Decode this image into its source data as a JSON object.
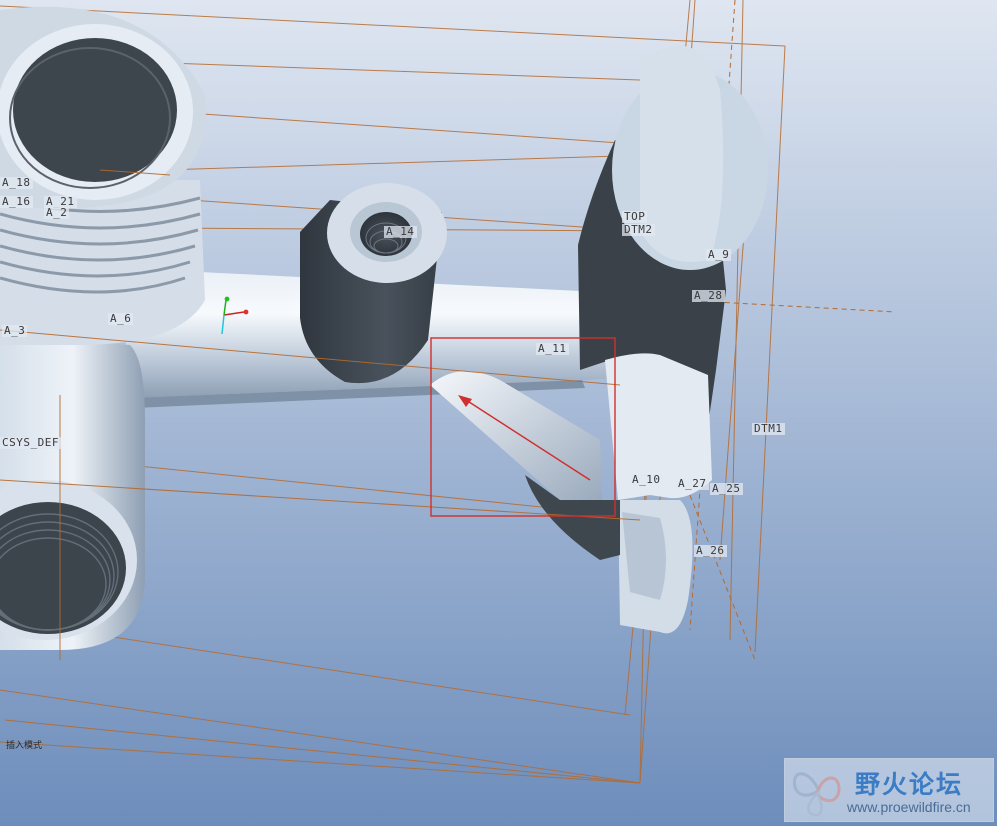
{
  "viewport": {
    "background_top": "#dfe6f1",
    "background_bottom": "#6d8dbb",
    "datum_color": "#b56a2e",
    "solid_color": "#c5d3e3",
    "shadow_color": "#3d454e"
  },
  "datum_labels": {
    "a18": "A_18",
    "a16": "A_16",
    "a21": "A_21",
    "a2": "A_2",
    "a3": "A_3",
    "a6": "A_6",
    "a14": "A_14",
    "a11": "A_11",
    "top": "TOP",
    "dtm2": "DTM2",
    "a9": "A_9",
    "a28": "A_28",
    "dtm1": "DTM1",
    "a10": "A_10",
    "a27": "A_27",
    "a25": "A_25",
    "a26": "A_26",
    "csys": "CSYS_DEF"
  },
  "annotation": {
    "box_color": "#d0302f",
    "arrow_color": "#d0302f"
  },
  "status_hint": "插入模式",
  "watermark": {
    "title": "野火论坛",
    "url": "www.proewildfire.cn"
  }
}
